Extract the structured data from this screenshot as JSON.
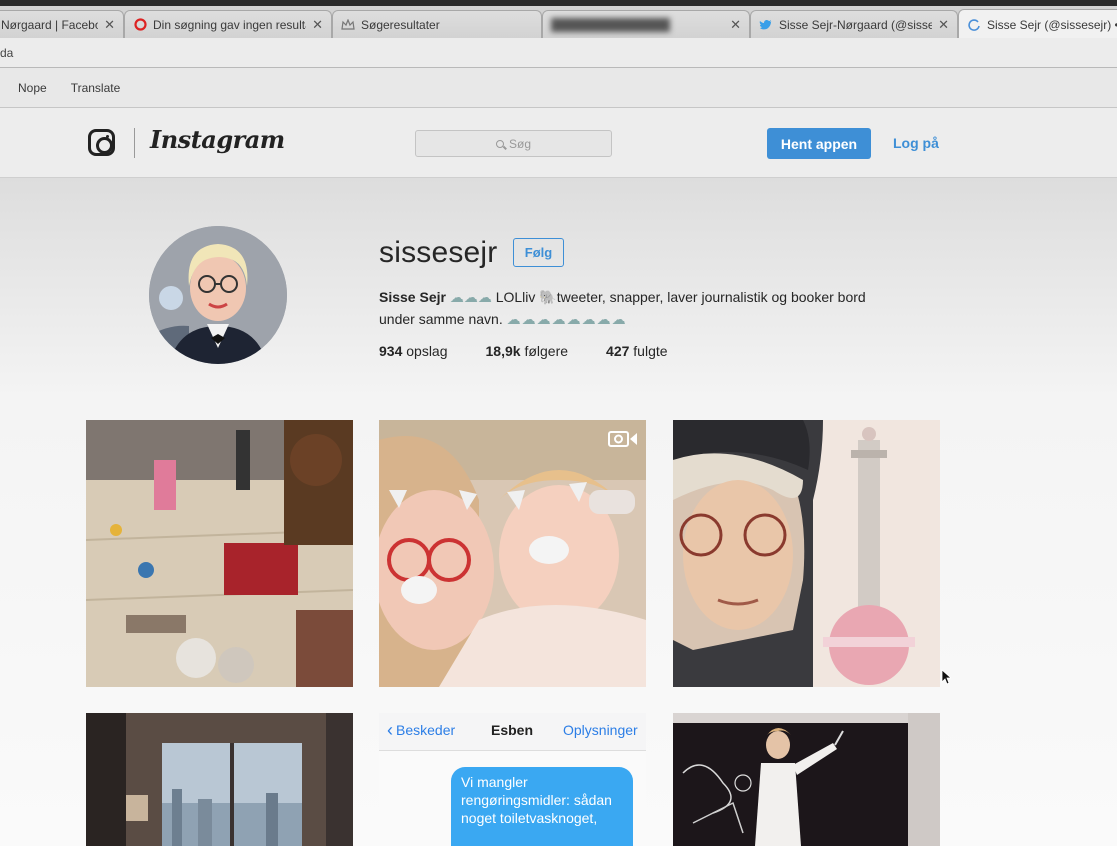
{
  "browser": {
    "tabs": [
      {
        "title": "Nørgaard | Facebo",
        "icon": "facebook-icon"
      },
      {
        "title": "Din søgning gav ingen resulta",
        "icon": "red-circle-icon"
      },
      {
        "title": "Søgeresultater",
        "icon": "crown-icon"
      },
      {
        "title": "",
        "icon": "blurred-icon"
      },
      {
        "title": "Sisse Sejr-Nørgaard (@sisses",
        "icon": "twitter-icon"
      },
      {
        "title": "Sisse Sejr (@sissesejr) • I",
        "icon": "loading-icon"
      }
    ],
    "url_fragment": "da",
    "bookmarks": [
      "Nope",
      "Translate"
    ]
  },
  "header": {
    "wordmark": "Instagram",
    "search_placeholder": "Søg",
    "get_app": "Hent appen",
    "login": "Log på"
  },
  "profile": {
    "username": "sissesejr",
    "follow": "Følg",
    "bio_name": "Sisse Sejr",
    "bio_line1_a": "LOLliv",
    "bio_line1_b": "tweeter, snapper, laver journalistik og booker bord",
    "bio_line2": "under samme navn.",
    "posts_count": "934",
    "posts_label": "opslag",
    "followers_count": "18,9k",
    "followers_label": "følgere",
    "following_count": "427",
    "following_label": "fulgte"
  },
  "messages_tile": {
    "back": "Beskeder",
    "title": "Esben",
    "info": "Oplysninger",
    "bubble": "Vi mangler rengøringsmidler: sådan noget toiletvasknoget,"
  },
  "colors": {
    "accent": "#3e8fd6",
    "imessage_blue": "#3aa8f2"
  }
}
